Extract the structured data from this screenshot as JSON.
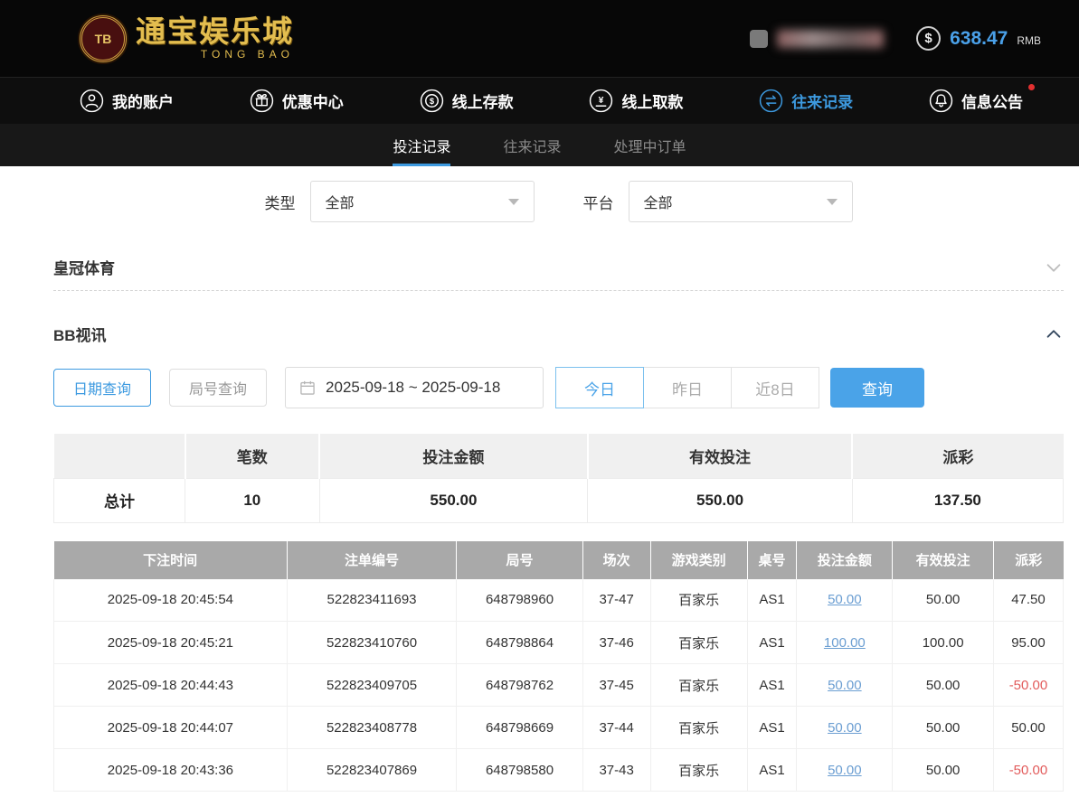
{
  "header": {
    "logo_badge": "TB",
    "logo_title": "通宝娱乐城",
    "logo_subtitle": "TONG BAO",
    "balance_symbol": "$",
    "balance_amount": "638.47",
    "balance_currency": "RMB"
  },
  "nav": {
    "items": [
      {
        "label": "我的账户"
      },
      {
        "label": "优惠中心"
      },
      {
        "label": "线上存款"
      },
      {
        "label": "线上取款"
      },
      {
        "label": "往来记录"
      },
      {
        "label": "信息公告"
      }
    ]
  },
  "tabs": [
    {
      "label": "投注记录"
    },
    {
      "label": "往来记录"
    },
    {
      "label": "处理中订单"
    }
  ],
  "filters": {
    "type_label": "类型",
    "type_value": "全部",
    "platform_label": "平台",
    "platform_value": "全部"
  },
  "sections": {
    "crown_sports": "皇冠体育",
    "bb_video": "BB视讯"
  },
  "query": {
    "date_query": "日期查询",
    "round_query": "局号查询",
    "date_range": "2025-09-18 ~ 2025-09-18",
    "today": "今日",
    "yesterday": "昨日",
    "last_8_days": "近8日",
    "search": "查询"
  },
  "summary": {
    "headers": [
      "笔数",
      "投注金额",
      "有效投注",
      "派彩"
    ],
    "total_label": "总计",
    "count": "10",
    "bet_amount": "550.00",
    "valid_bet": "550.00",
    "payout": "137.50"
  },
  "table": {
    "headers": [
      "下注时间",
      "注单编号",
      "局号",
      "场次",
      "游戏类别",
      "桌号",
      "投注金额",
      "有效投注",
      "派彩"
    ],
    "rows": [
      [
        "2025-09-18 20:45:54",
        "522823411693",
        "648798960",
        "37-47",
        "百家乐",
        "AS1",
        "50.00",
        "50.00",
        "47.50"
      ],
      [
        "2025-09-18 20:45:21",
        "522823410760",
        "648798864",
        "37-46",
        "百家乐",
        "AS1",
        "100.00",
        "100.00",
        "95.00"
      ],
      [
        "2025-09-18 20:44:43",
        "522823409705",
        "648798762",
        "37-45",
        "百家乐",
        "AS1",
        "50.00",
        "50.00",
        "-50.00"
      ],
      [
        "2025-09-18 20:44:07",
        "522823408778",
        "648798669",
        "37-44",
        "百家乐",
        "AS1",
        "50.00",
        "50.00",
        "50.00"
      ],
      [
        "2025-09-18 20:43:36",
        "522823407869",
        "648798580",
        "37-43",
        "百家乐",
        "AS1",
        "50.00",
        "50.00",
        "-50.00"
      ]
    ]
  },
  "colors": {
    "accent_blue": "#3d9ae0",
    "gold": "#e3bd4f",
    "negative_red": "#e25b5b",
    "link_blue": "#6b9ed2",
    "table_header_gray": "#a9a9a9"
  }
}
